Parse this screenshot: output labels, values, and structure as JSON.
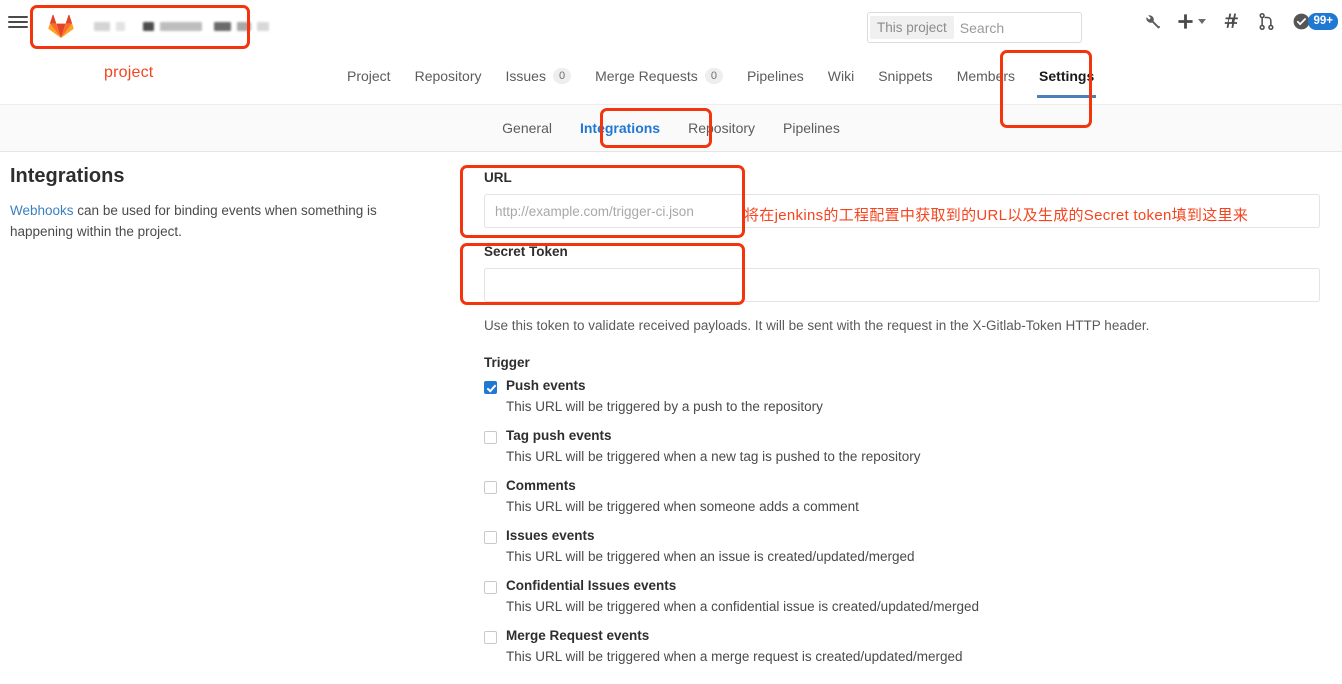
{
  "topbar": {
    "menu_icon": "hamburger-icon",
    "logo_icon": "gitlab-fox-logo",
    "breadcrumb_redacted": true,
    "project_caption": "project",
    "search": {
      "scope_label": "This project",
      "placeholder": "Search",
      "value": "",
      "icon": "search-icon"
    },
    "icons": [
      {
        "name": "wrench-icon",
        "label": "Admin area"
      },
      {
        "name": "plus-icon",
        "label": "New"
      },
      {
        "name": "issues-hash-icon",
        "label": "Issues"
      },
      {
        "name": "merge-request-icon",
        "label": "Merge requests"
      },
      {
        "name": "todos-check-icon",
        "label": "Todos"
      }
    ],
    "todo_count": "99+"
  },
  "mainnav": {
    "items": [
      {
        "label": "Project",
        "count": null,
        "active": false
      },
      {
        "label": "Repository",
        "count": null,
        "active": false
      },
      {
        "label": "Issues",
        "count": "0",
        "active": false
      },
      {
        "label": "Merge Requests",
        "count": "0",
        "active": false
      },
      {
        "label": "Pipelines",
        "count": null,
        "active": false
      },
      {
        "label": "Wiki",
        "count": null,
        "active": false
      },
      {
        "label": "Snippets",
        "count": null,
        "active": false
      },
      {
        "label": "Members",
        "count": null,
        "active": false
      },
      {
        "label": "Settings",
        "count": null,
        "active": true
      }
    ]
  },
  "subnav": {
    "items": [
      {
        "label": "General",
        "active": false
      },
      {
        "label": "Integrations",
        "active": true
      },
      {
        "label": "Repository",
        "active": false
      },
      {
        "label": "Pipelines",
        "active": false
      }
    ]
  },
  "left": {
    "title": "Integrations",
    "desc_link": "Webhooks",
    "desc_rest": " can be used for binding events when something is happening within the project."
  },
  "form": {
    "url_label": "URL",
    "url_placeholder": "http://example.com/trigger-ci.json",
    "url_value": "",
    "token_label": "Secret Token",
    "token_placeholder": "",
    "token_value": "",
    "token_help": "Use this token to validate received payloads. It will be sent with the request in the X-Gitlab-Token HTTP header.",
    "trigger_title": "Trigger",
    "triggers": [
      {
        "label": "Push events",
        "checked": true,
        "desc": "This URL will be triggered by a push to the repository"
      },
      {
        "label": "Tag push events",
        "checked": false,
        "desc": "This URL will be triggered when a new tag is pushed to the repository"
      },
      {
        "label": "Comments",
        "checked": false,
        "desc": "This URL will be triggered when someone adds a comment"
      },
      {
        "label": "Issues events",
        "checked": false,
        "desc": "This URL will be triggered when an issue is created/updated/merged"
      },
      {
        "label": "Confidential Issues events",
        "checked": false,
        "desc": "This URL will be triggered when a confidential issue is created/updated/merged"
      },
      {
        "label": "Merge Request events",
        "checked": false,
        "desc": "This URL will be triggered when a merge request is created/updated/merged"
      }
    ]
  },
  "annotations": {
    "color": "#f4340c",
    "text_color": "#f4451f",
    "note": "将在jenkins的工程配置中获取到的URL以及生成的Secret token填到这里来"
  }
}
